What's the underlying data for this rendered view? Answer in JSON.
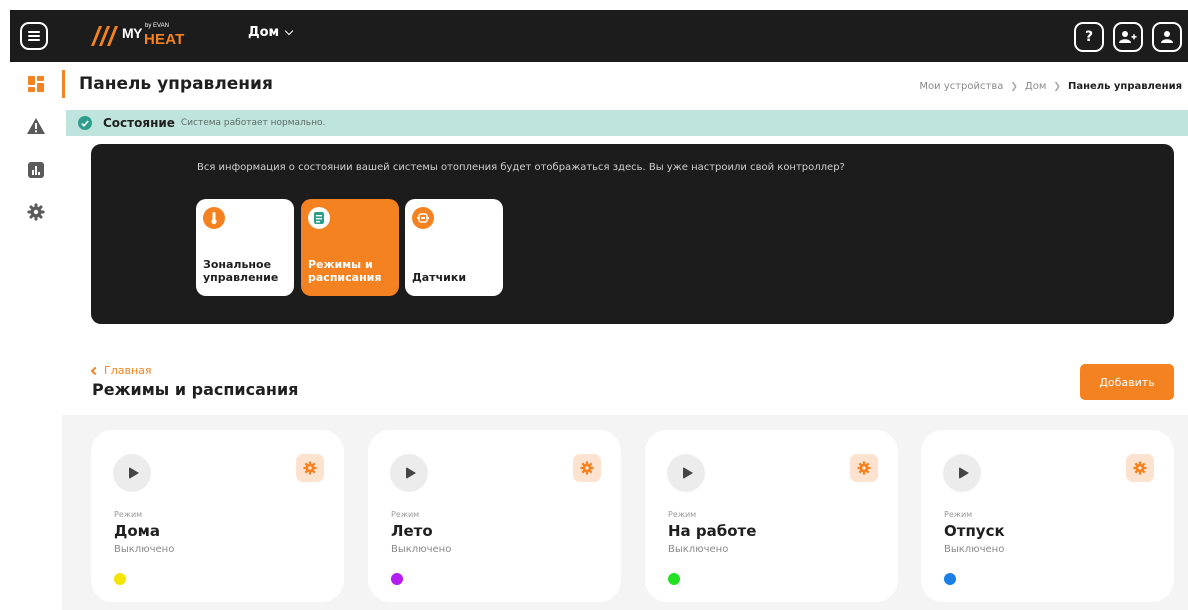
{
  "header": {
    "logo": {
      "my": "MY",
      "by": "by EVAN",
      "heat": "HEAT"
    },
    "home_select": "Дом",
    "icons": [
      "help-icon",
      "add-user-icon",
      "user-icon"
    ],
    "help_symbol": "?"
  },
  "sidebar": {
    "items": [
      {
        "icon": "dashboard-icon",
        "color": "#f58220"
      },
      {
        "icon": "warning-icon",
        "color": "#5a5a5a"
      },
      {
        "icon": "chart-icon",
        "color": "#5a5a5a"
      },
      {
        "icon": "gear-icon",
        "color": "#5a5a5a"
      }
    ]
  },
  "page": {
    "title": "Панель управления",
    "breadcrumb": [
      "Мои устройства",
      "Дом",
      "Панель управления"
    ]
  },
  "status": {
    "label": "Состояние",
    "text": "Система работает нормально.",
    "color": "#bfe4dd"
  },
  "info": {
    "text": "Вся информация о состоянии вашей системы отопления будет отображаться здесь. Вы уже настроили свой контроллер?",
    "tiles": [
      {
        "label": "Зональное управление",
        "icon": "thermometer-icon",
        "active": false
      },
      {
        "label": "Режимы и расписания",
        "icon": "document-icon",
        "active": true
      },
      {
        "label": "Датчики",
        "icon": "sensor-icon",
        "active": false
      }
    ]
  },
  "section": {
    "back_label": "Главная",
    "title": "Режимы и расписания",
    "add_button": "Добавить"
  },
  "modes": [
    {
      "caption": "Режим",
      "name": "Дома",
      "state": "Выключено",
      "color": "#f5e400"
    },
    {
      "caption": "Режим",
      "name": "Лето",
      "state": "Выключено",
      "color": "#b41cf0"
    },
    {
      "caption": "Режим",
      "name": "На работе",
      "state": "Выключено",
      "color": "#22e022"
    },
    {
      "caption": "Режим",
      "name": "Отпуск",
      "state": "Выключено",
      "color": "#1a7fe6"
    }
  ],
  "colors": {
    "accent": "#f58220",
    "dark": "#1c1c1c"
  }
}
